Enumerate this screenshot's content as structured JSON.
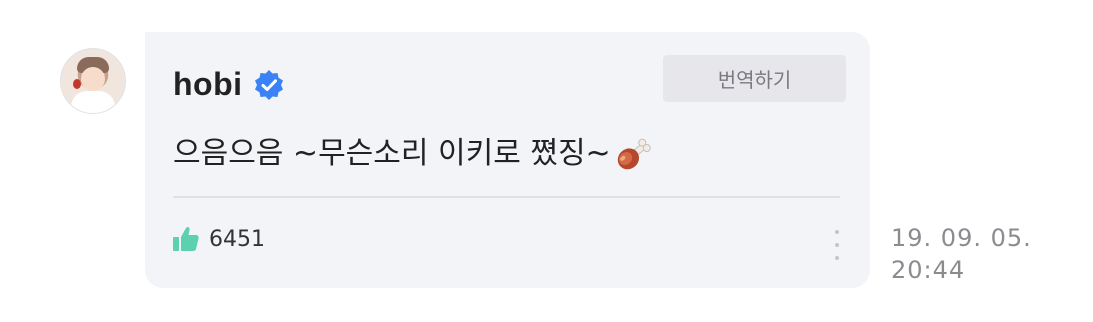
{
  "post": {
    "author": "hobi",
    "verified_icon": "verified-badge-icon",
    "translate_label": "번역하기",
    "message": "으음으음 ~무슨소리 이키로 쪘징~",
    "emoji": "meat-on-bone-icon",
    "likes": "6451",
    "like_icon": "thumbs-up-icon",
    "more_icon": "vertical-dots-icon",
    "date": "19. 09. 05.",
    "time": "20:44"
  },
  "colors": {
    "bubble_bg": "#f3f4f8",
    "verified": "#3b82f6",
    "like": "#5bd1b0",
    "timestamp": "#8b8b90"
  }
}
